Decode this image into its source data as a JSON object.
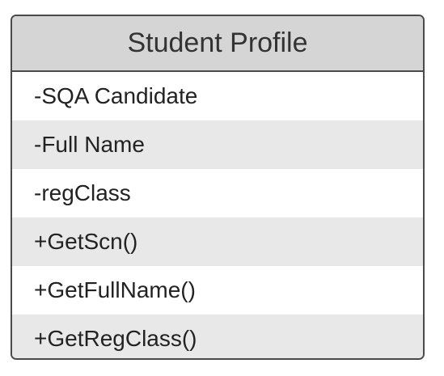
{
  "class_box": {
    "title": "Student Profile",
    "attributes": [
      "-SQA Candidate",
      "-Full Name",
      "-regClass"
    ],
    "methods": [
      "+GetScn()",
      "+GetFullName()",
      "+GetRegClass()"
    ]
  }
}
